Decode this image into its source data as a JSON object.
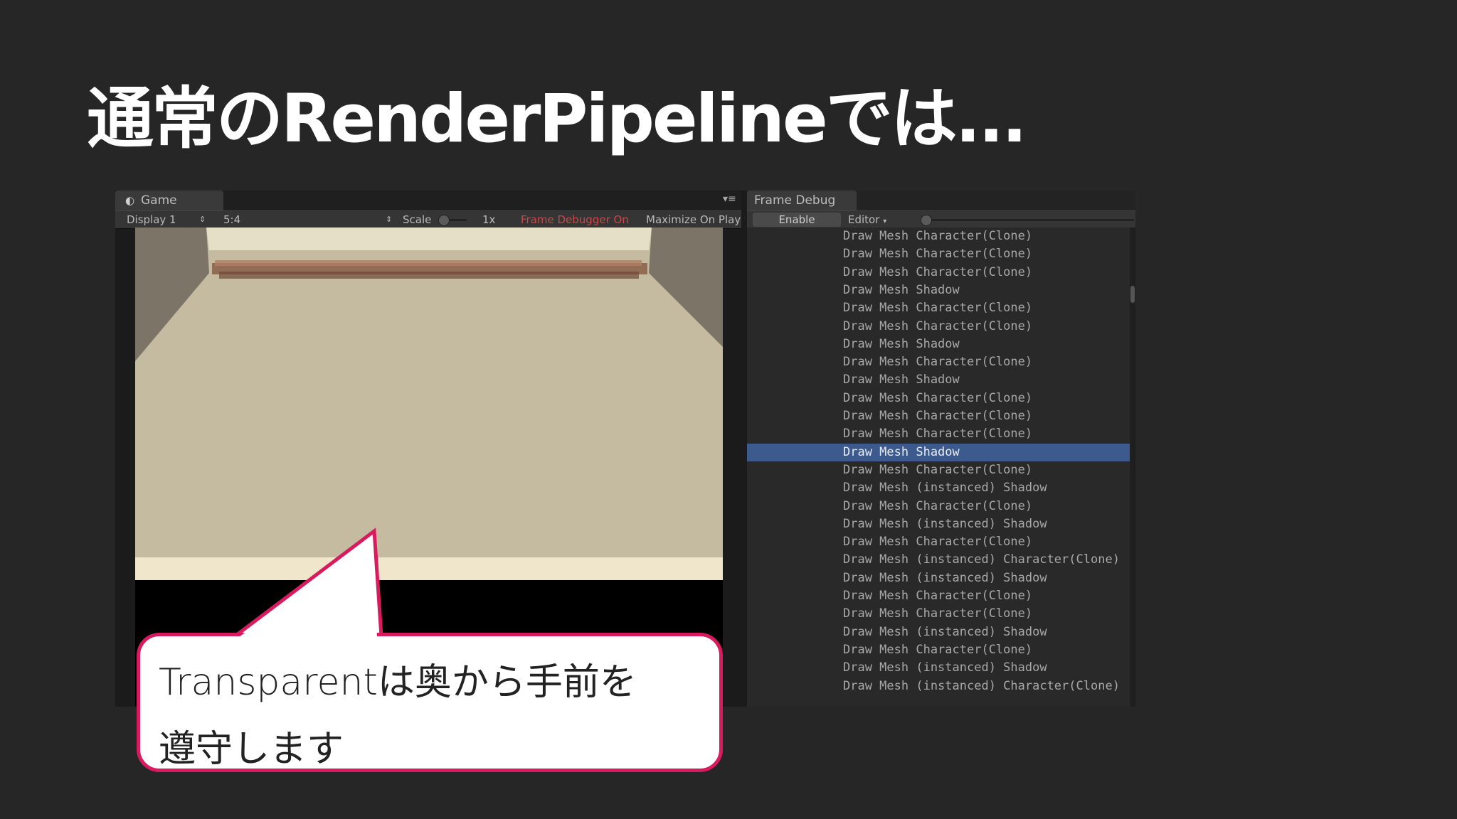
{
  "slide": {
    "title": "通常のRenderPipelineでは..."
  },
  "game_window": {
    "tab_label": "Game",
    "tab_icon": "pacman-icon",
    "menu_icon": "hamburger-menu-icon",
    "toolbar": {
      "display": "Display 1",
      "aspect": "5:4",
      "scale_label": "Scale",
      "scale_value": "1x",
      "frame_debugger_status": "Frame Debugger On",
      "maximize": "Maximize On Play"
    }
  },
  "frame_debug": {
    "tab_label": "Frame Debug",
    "enable_button": "Enable",
    "target": "Editor",
    "selected_index": 12,
    "events": [
      "Draw Mesh Character(Clone)",
      "Draw Mesh Character(Clone)",
      "Draw Mesh Character(Clone)",
      "Draw Mesh Shadow",
      "Draw Mesh Character(Clone)",
      "Draw Mesh Character(Clone)",
      "Draw Mesh Shadow",
      "Draw Mesh Character(Clone)",
      "Draw Mesh Shadow",
      "Draw Mesh Character(Clone)",
      "Draw Mesh Character(Clone)",
      "Draw Mesh Character(Clone)",
      "Draw Mesh Shadow",
      "Draw Mesh Character(Clone)",
      "Draw Mesh (instanced) Shadow",
      "Draw Mesh Character(Clone)",
      "Draw Mesh (instanced) Shadow",
      "Draw Mesh Character(Clone)",
      "Draw Mesh (instanced) Character(Clone)",
      "Draw Mesh (instanced) Shadow",
      "Draw Mesh Character(Clone)",
      "Draw Mesh Character(Clone)",
      "Draw Mesh (instanced) Shadow",
      "Draw Mesh Character(Clone)",
      "Draw Mesh (instanced) Shadow",
      "Draw Mesh (instanced) Character(Clone)"
    ]
  },
  "callout": {
    "line1": "Transparentは奥から手前を",
    "line2": "遵守します",
    "border_color": "#d81b5f"
  },
  "colors": {
    "background": "#262627",
    "selection": "#3c5a8e"
  }
}
